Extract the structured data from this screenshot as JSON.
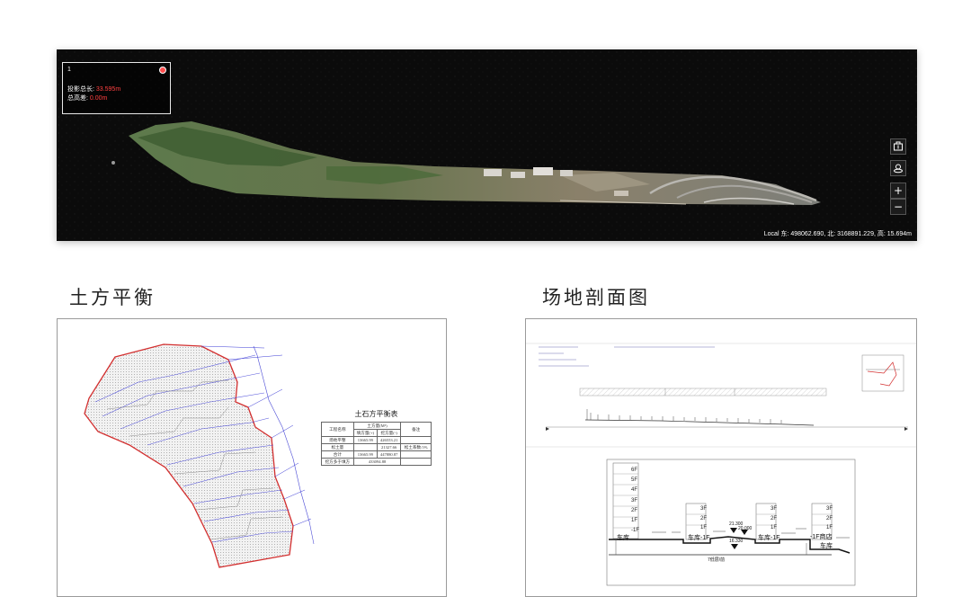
{
  "viewer": {
    "panel_index": "1",
    "measure_length_label": "投影总长:",
    "measure_length_value": "33.595m",
    "height_diff_label": "总高差:",
    "height_diff_value": "0.00m",
    "coordinates": "Local 东: 498062.690, 北: 3168891.229, 高: 15.694m",
    "tools": [
      {
        "name": "compare-icon"
      },
      {
        "name": "location-icon"
      },
      {
        "label": "+",
        "name": "zoom-in"
      },
      {
        "label": "−",
        "name": "zoom-out"
      }
    ]
  },
  "sections": {
    "left_title": "土方平衡",
    "right_title": "场地剖面图"
  },
  "earthwork": {
    "table_title": "土石方平衡表",
    "header": {
      "item": "工程名称",
      "volume": "土方量(M³)",
      "note": "备注",
      "fill": "填方量(+)",
      "cut": "挖方量(-)"
    },
    "rows": [
      {
        "name": "场地平整",
        "fill": "13665.99",
        "cut": "426553.21",
        "note": ""
      },
      {
        "name": "松土量",
        "fill": "",
        "cut": "21327.66",
        "note": "松土系数:5%"
      },
      {
        "name": "合计",
        "fill": "13665.99",
        "cut": "447880.87",
        "note": ""
      },
      {
        "name": "挖方多于填方",
        "fill": "433094.88",
        "cut": "",
        "note": ""
      }
    ]
  },
  "section": {
    "floors_main": [
      "6F",
      "5F",
      "4F",
      "3F",
      "2F",
      "1F",
      "-1F"
    ],
    "floors_b": [
      "3F",
      "2F",
      "1F"
    ],
    "floors_c": [
      "3F",
      "2F",
      "1F"
    ],
    "floors_d": [
      "3F",
      "2F",
      "1F"
    ],
    "garage": "车库",
    "garage_b": "车库-1F",
    "garage_c": "车库-1F",
    "garage_d_top": "-1F商店",
    "garage_d": "车库",
    "elev_1": "21.300",
    "elev_2": "20.000",
    "elev_3": "16.330",
    "ground": "7低层/前"
  }
}
